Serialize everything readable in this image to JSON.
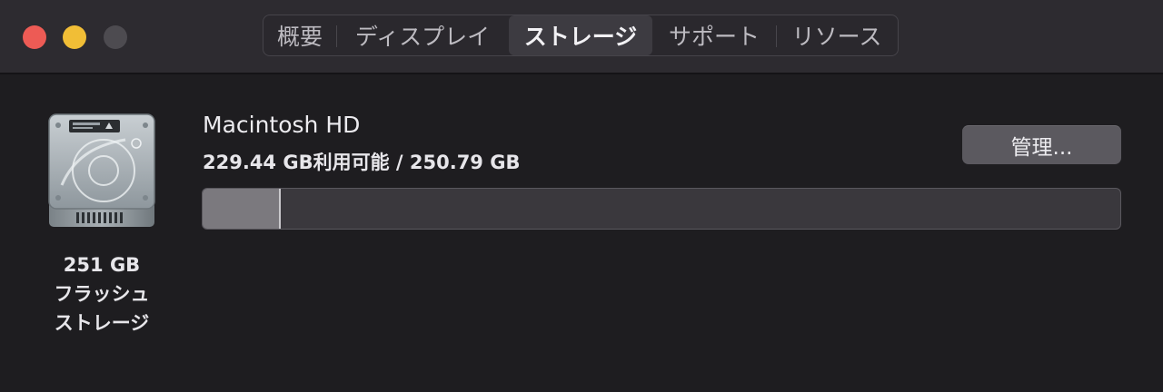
{
  "window": {
    "traffic_lights": {
      "close_color": "#ed5b55",
      "minimize_color": "#f1be36",
      "zoom_color": "#4d4b50"
    },
    "tabs": [
      {
        "label": "概要",
        "active": false
      },
      {
        "label": "ディスプレイ",
        "active": false
      },
      {
        "label": "ストレージ",
        "active": true
      },
      {
        "label": "サポート",
        "active": false
      },
      {
        "label": "リソース",
        "active": false
      }
    ]
  },
  "disk": {
    "icon": "internal-drive-icon",
    "size_label": "251 GB",
    "type_line1": "フラッシュ",
    "type_line2": "ストレージ"
  },
  "volume": {
    "name": "Macintosh HD",
    "info": "229.44 GB利用可能 / 250.79 GB",
    "manage_label": "管理...",
    "used_fraction": 0.085
  }
}
